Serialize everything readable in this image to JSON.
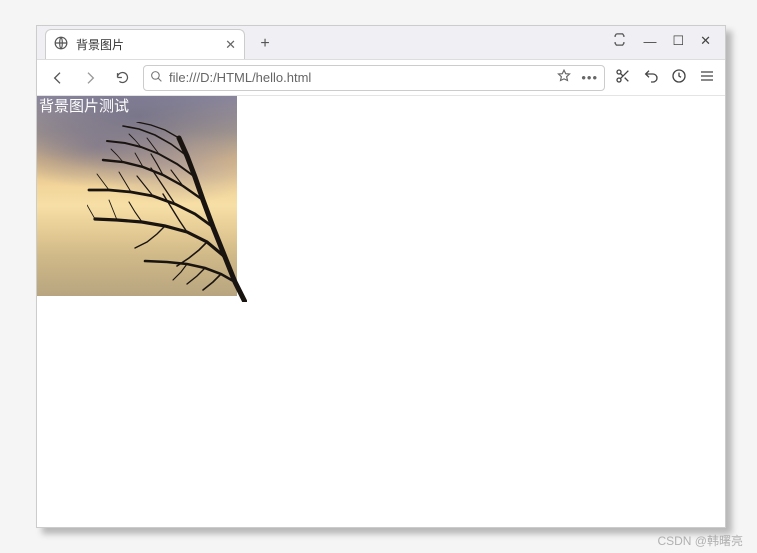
{
  "tab": {
    "title": "背景图片"
  },
  "window_controls": {
    "screenshot": "⛶",
    "minimize": "—",
    "maximize": "☐",
    "close": "✕"
  },
  "toolbar": {
    "url": "file:///D:/HTML/hello.html"
  },
  "content": {
    "bg_label": "背景图片测试"
  },
  "watermark": "CSDN @韩曙亮"
}
